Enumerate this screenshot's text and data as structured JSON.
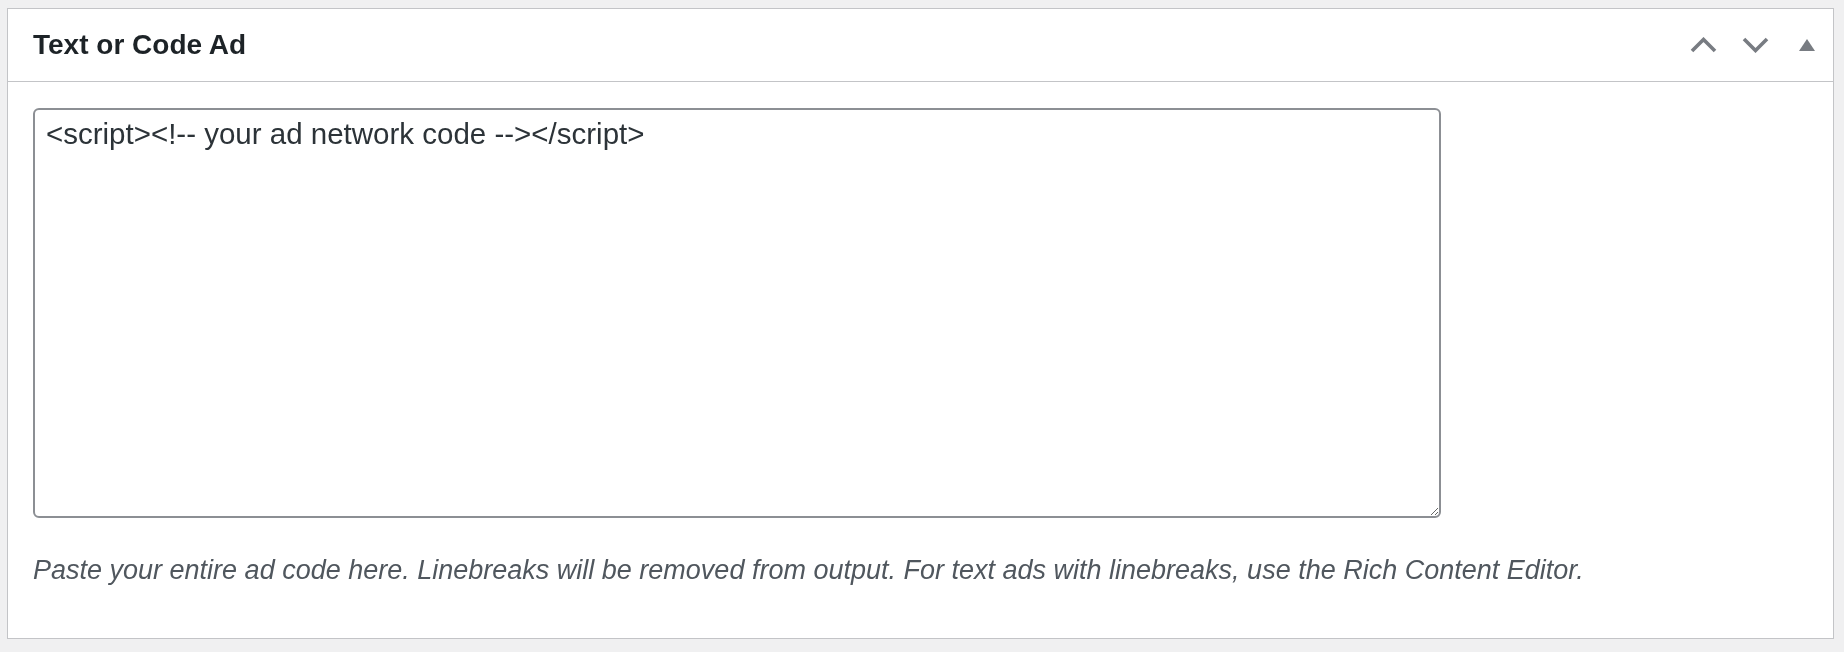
{
  "panel": {
    "title": "Text or Code Ad",
    "expanded": true,
    "controls": [
      {
        "kind": "move-up"
      },
      {
        "kind": "move-down"
      },
      {
        "kind": "toggle"
      }
    ]
  },
  "code_field": {
    "value": "<script><!-- your ad network code --></script>"
  },
  "help_text": "Paste your entire ad code here. Linebreaks will be removed from output. For text ads with linebreaks, use the Rich Content Editor."
}
